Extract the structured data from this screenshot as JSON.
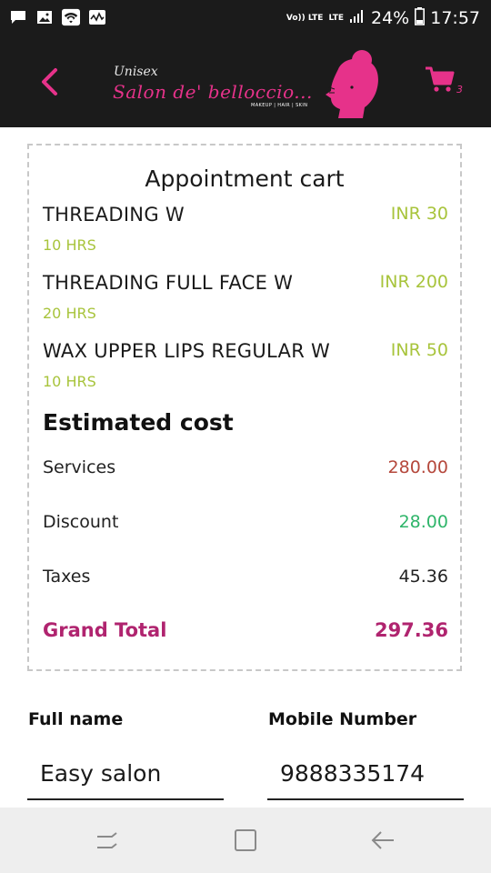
{
  "status_bar": {
    "volte": "Vo)) LTE",
    "lte": "LTE",
    "battery": "24%",
    "time": "17:57",
    "icons": [
      "chat-notification-icon",
      "gallery-icon",
      "wifi-icon",
      "activity-icon"
    ]
  },
  "header": {
    "brand_top": "Unisex",
    "brand_name": "Salon de' belloccio...",
    "brand_tagline": "MAKEUP | HAIR | SKIN",
    "cart_count": "3",
    "accent_color": "#e6328a",
    "background_color": "#1b1b1b"
  },
  "cart": {
    "title": "Appointment cart",
    "items": [
      {
        "name": "THREADING W",
        "price": "INR 30",
        "duration": "10 HRS"
      },
      {
        "name": "THREADING FULL FACE W",
        "price": "INR 200",
        "duration": "20 HRS"
      },
      {
        "name": "WAX UPPER LIPS REGULAR W",
        "price": "INR 50",
        "duration": "10 HRS"
      }
    ],
    "estimated_title": "Estimated cost",
    "services_label": "Services",
    "services_value": "280.00",
    "discount_label": "Discount",
    "discount_value": "28.00",
    "taxes_label": "Taxes",
    "taxes_value": "45.36",
    "grand_total_label": "Grand Total",
    "grand_total_value": "297.36",
    "colors": {
      "price": "#a8c43c",
      "services": "#b5483c",
      "discount": "#2fb56a",
      "grand_total": "#b0246f"
    }
  },
  "form": {
    "full_name_label": "Full name",
    "full_name_value": "Easy salon",
    "mobile_label": "Mobile Number",
    "mobile_value": "9888335174"
  },
  "nav_bar": {
    "buttons": [
      "recent-apps-icon",
      "home-icon",
      "back-icon"
    ]
  }
}
